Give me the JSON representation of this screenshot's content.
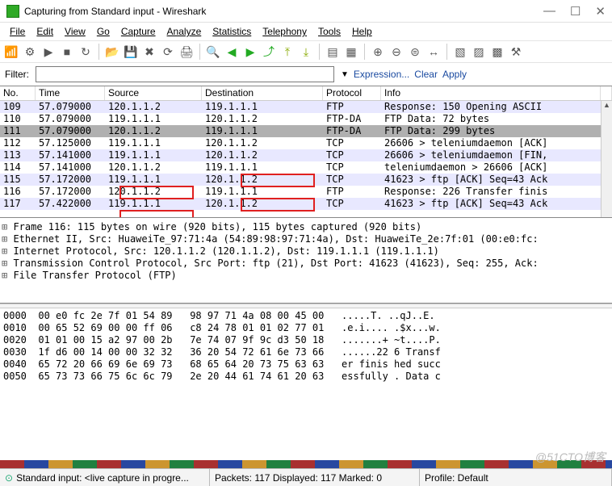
{
  "window": {
    "title": "Capturing from Standard input - Wireshark"
  },
  "winbtns": {
    "min": "—",
    "max": "☐",
    "close": "✕"
  },
  "menu": [
    "File",
    "Edit",
    "View",
    "Go",
    "Capture",
    "Analyze",
    "Statistics",
    "Telephony",
    "Tools",
    "Help"
  ],
  "filter": {
    "label": "Filter:",
    "value": "",
    "expression": "Expression...",
    "clear": "Clear",
    "apply": "Apply"
  },
  "columns": {
    "no": "No.",
    "time": "Time",
    "src": "Source",
    "dst": "Destination",
    "proto": "Protocol",
    "info": "Info"
  },
  "packets": [
    {
      "no": "109",
      "time": "57.079000",
      "src": "120.1.1.2",
      "dst": "119.1.1.1",
      "proto": "FTP",
      "info": "Response: 150 Opening ASCII",
      "alt": true
    },
    {
      "no": "110",
      "time": "57.079000",
      "src": "119.1.1.1",
      "dst": "120.1.1.2",
      "proto": "FTP-DA",
      "info": "FTP Data: 72 bytes",
      "alt": false
    },
    {
      "no": "111",
      "time": "57.079000",
      "src": "120.1.1.2",
      "dst": "119.1.1.1",
      "proto": "FTP-DA",
      "info": "FTP Data: 299 bytes",
      "sel": true
    },
    {
      "no": "112",
      "time": "57.125000",
      "src": "119.1.1.1",
      "dst": "120.1.1.2",
      "proto": "TCP",
      "info": "26606 > teleniumdaemon [ACK]",
      "alt": false
    },
    {
      "no": "113",
      "time": "57.141000",
      "src": "119.1.1.1",
      "dst": "120.1.1.2",
      "proto": "TCP",
      "info": "26606 > teleniumdaemon [FIN,",
      "alt": true
    },
    {
      "no": "114",
      "time": "57.141000",
      "src": "120.1.1.2",
      "dst": "119.1.1.1",
      "proto": "TCP",
      "info": "teleniumdaemon > 26606 [ACK]",
      "alt": false
    },
    {
      "no": "115",
      "time": "57.172000",
      "src": "119.1.1.1",
      "dst": "120.1.1.2",
      "proto": "TCP",
      "info": "41623 > ftp [ACK] Seq=43 Ack",
      "alt": true
    },
    {
      "no": "116",
      "time": "57.172000",
      "src": "120.1.1.2",
      "dst": "119.1.1.1",
      "proto": "FTP",
      "info": "Response: 226 Transfer finis",
      "alt": false
    },
    {
      "no": "117",
      "time": "57.422000",
      "src": "119.1.1.1",
      "dst": "120.1.1.2",
      "proto": "TCP",
      "info": "41623 > ftp [ACK] Seq=43 Ack",
      "alt": true
    }
  ],
  "details": [
    "Frame 116: 115 bytes on wire (920 bits), 115 bytes captured (920 bits)",
    "Ethernet II, Src: HuaweiTe_97:71:4a (54:89:98:97:71:4a), Dst: HuaweiTe_2e:7f:01 (00:e0:fc:",
    "Internet Protocol, Src: 120.1.1.2 (120.1.1.2), Dst: 119.1.1.1 (119.1.1.1)",
    "Transmission Control Protocol, Src Port: ftp (21), Dst Port: 41623 (41623), Seq: 255, Ack:",
    "File Transfer Protocol (FTP)"
  ],
  "hex": [
    {
      "off": "0000",
      "b": "00 e0 fc 2e 7f 01 54 89   98 97 71 4a 08 00 45 00",
      "a": ".....T. ..qJ..E."
    },
    {
      "off": "0010",
      "b": "00 65 52 69 00 00 ff 06   c8 24 78 01 01 02 77 01",
      "a": ".e.i.... .$x...w."
    },
    {
      "off": "0020",
      "b": "01 01 00 15 a2 97 00 2b   7e 74 07 9f 9c d3 50 18",
      "a": ".......+ ~t....P."
    },
    {
      "off": "0030",
      "b": "1f d6 00 14 00 00 32 32   36 20 54 72 61 6e 73 66",
      "a": "......22 6 Transf"
    },
    {
      "off": "0040",
      "b": "65 72 20 66 69 6e 69 73   68 65 64 20 73 75 63 63",
      "a": "er finis hed succ"
    },
    {
      "off": "0050",
      "b": "65 73 73 66 75 6c 6c 79   2e 20 44 61 74 61 20 63",
      "a": "essfully . Data c"
    }
  ],
  "status": {
    "s1": "Standard input: <live capture in progre...",
    "s2": "Packets: 117 Displayed: 117 Marked: 0",
    "s3": "Profile: Default"
  },
  "watermark": "@51CTO博客"
}
